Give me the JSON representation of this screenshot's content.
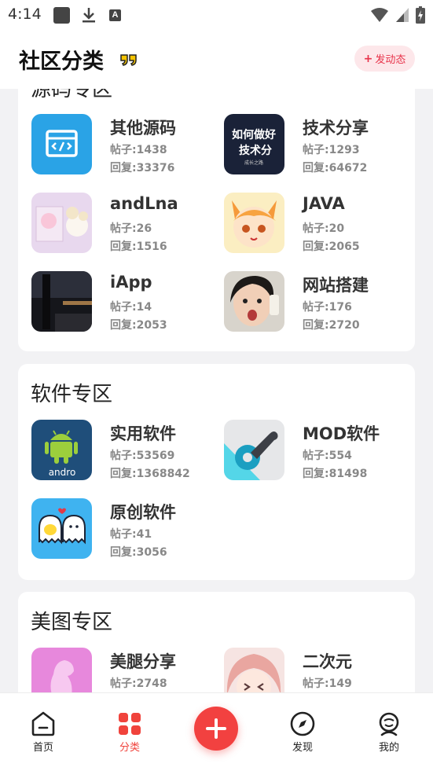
{
  "status_bar": {
    "time": "4:14"
  },
  "header": {
    "title": "社区分类",
    "post_button": {
      "plus": "+",
      "label": "发动态"
    }
  },
  "sections": [
    {
      "title": "源码专区",
      "items": [
        {
          "name": "其他源码",
          "posts": "帖子:1438",
          "replies": "回复:33376",
          "thumb_text": ""
        },
        {
          "name": "技术分享",
          "posts": "帖子:1293",
          "replies": "回复:64672",
          "thumb_text": [
            "如何做好",
            "技术分",
            "成长之路"
          ]
        },
        {
          "name": "andLna",
          "posts": "帖子:26",
          "replies": "回复:1516"
        },
        {
          "name": "JAVA",
          "posts": "帖子:20",
          "replies": "回复:2065"
        },
        {
          "name": "iApp",
          "posts": "帖子:14",
          "replies": "回复:2053"
        },
        {
          "name": "网站搭建",
          "posts": "帖子:176",
          "replies": "回复:2720"
        }
      ]
    },
    {
      "title": "软件专区",
      "items": [
        {
          "name": "实用软件",
          "posts": "帖子:53569",
          "replies": "回复:1368842",
          "thumb_text": "andro"
        },
        {
          "name": "MOD软件",
          "posts": "帖子:554",
          "replies": "回复:81498"
        },
        {
          "name": "原创软件",
          "posts": "帖子:41",
          "replies": "回复:3056"
        }
      ]
    },
    {
      "title": "美图专区",
      "items": [
        {
          "name": "美腿分享",
          "posts": "帖子:2748",
          "replies": ""
        },
        {
          "name": "二次元",
          "posts": "帖子:149",
          "replies": ""
        }
      ]
    }
  ],
  "bottom_nav": {
    "home": "首页",
    "category": "分类",
    "discover": "发现",
    "mine": "我的"
  },
  "colors": {
    "accent": "#f0433c",
    "post_button_bg": "#fde7ea",
    "page_bg": "#f2f2f4"
  }
}
